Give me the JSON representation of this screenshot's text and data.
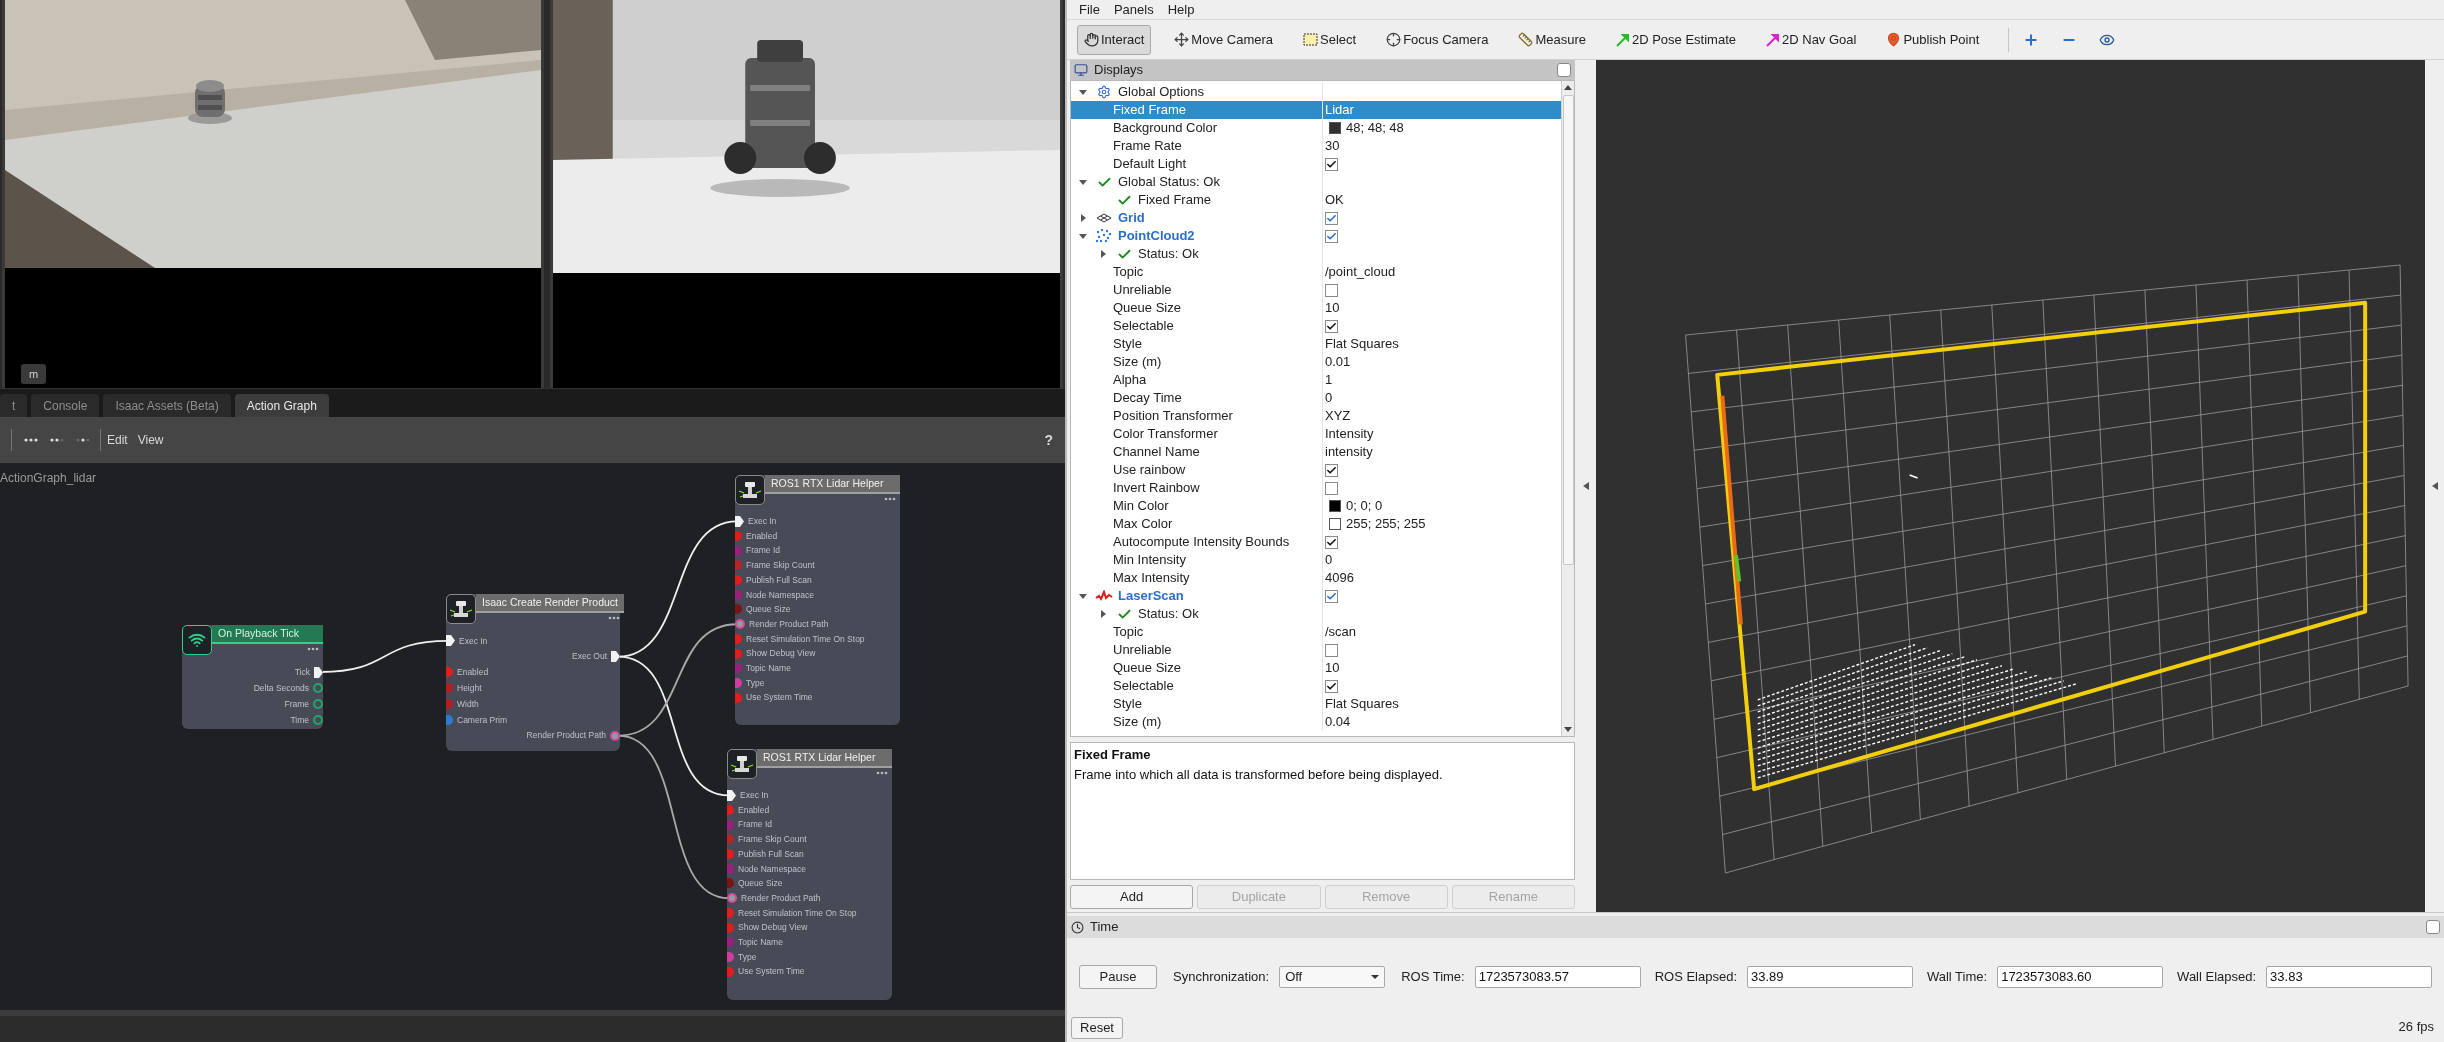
{
  "viewport": {
    "badge": "m"
  },
  "graph_editor": {
    "tabs": [
      {
        "label": "t",
        "selected": false
      },
      {
        "label": "Console",
        "selected": false
      },
      {
        "label": "Isaac Assets (Beta)",
        "selected": false
      },
      {
        "label": "Action Graph",
        "selected": true
      }
    ],
    "menu": [
      "Edit",
      "View"
    ],
    "help": "?",
    "graph_name": "ActionGraph_lidar",
    "nodes": [
      {
        "title": "On Playback Tick",
        "kind": "event",
        "ports": [
          {
            "label": "Tick",
            "kind": "exec_out"
          },
          {
            "label": "Delta Seconds",
            "kind": "ring_out",
            "color": "#1fa866"
          },
          {
            "label": "Frame",
            "kind": "ring_out",
            "color": "#1fa866"
          },
          {
            "label": "Time",
            "kind": "ring_out",
            "color": "#1fa866"
          }
        ]
      },
      {
        "title": "Isaac Create Render Product",
        "kind": "tool",
        "ports": [
          {
            "label": "Exec In",
            "kind": "exec_in"
          },
          {
            "label": "Exec Out",
            "kind": "exec_out"
          },
          {
            "label": "Enabled",
            "kind": "data_in",
            "color": "#e21d1d"
          },
          {
            "label": "Height",
            "kind": "data_in",
            "color": "#b01e22"
          },
          {
            "label": "Width",
            "kind": "data_in",
            "color": "#b01e22"
          },
          {
            "label": "Camera Prim",
            "kind": "data_in",
            "color": "#2e7bd6"
          },
          {
            "label": "Render Product Path",
            "kind": "dot_out",
            "color": "#d04aa0"
          }
        ]
      },
      {
        "title": "ROS1 RTX Lidar Helper",
        "kind": "tool",
        "ports": [
          {
            "label": "Exec In",
            "kind": "exec_in"
          },
          {
            "label": "Enabled",
            "kind": "data_in",
            "color": "#e21d1d"
          },
          {
            "label": "Frame Id",
            "kind": "data_in",
            "color": "#9b1f7c"
          },
          {
            "label": "Frame Skip Count",
            "kind": "data_in",
            "color": "#b0262a"
          },
          {
            "label": "Publish Full Scan",
            "kind": "data_in",
            "color": "#e21d1d"
          },
          {
            "label": "Node Namespace",
            "kind": "data_in",
            "color": "#9b1f7c"
          },
          {
            "label": "Queue Size",
            "kind": "data_in",
            "color": "#7a1515"
          },
          {
            "label": "Render Product Path",
            "kind": "dot_in",
            "color": "#d04aa0"
          },
          {
            "label": "Reset Simulation Time On Stop",
            "kind": "data_in",
            "color": "#e21d1d"
          },
          {
            "label": "Show Debug View",
            "kind": "data_in",
            "color": "#e21d1d"
          },
          {
            "label": "Topic Name",
            "kind": "data_in",
            "color": "#9b1f7c"
          },
          {
            "label": "Type",
            "kind": "data_in",
            "color": "#d23ca0"
          },
          {
            "label": "Use System Time",
            "kind": "data_in",
            "color": "#e21d1d"
          }
        ]
      },
      {
        "title": "ROS1 RTX Lidar Helper",
        "kind": "tool",
        "ports": [
          {
            "label": "Exec In",
            "kind": "exec_in"
          },
          {
            "label": "Enabled",
            "kind": "data_in",
            "color": "#e21d1d"
          },
          {
            "label": "Frame Id",
            "kind": "data_in",
            "color": "#9b1f7c"
          },
          {
            "label": "Frame Skip Count",
            "kind": "data_in",
            "color": "#b0262a"
          },
          {
            "label": "Publish Full Scan",
            "kind": "data_in",
            "color": "#e21d1d"
          },
          {
            "label": "Node Namespace",
            "kind": "data_in",
            "color": "#9b1f7c"
          },
          {
            "label": "Queue Size",
            "kind": "data_in",
            "color": "#7a1515"
          },
          {
            "label": "Render Product Path",
            "kind": "dot_in",
            "color": "#d04aa0"
          },
          {
            "label": "Reset Simulation Time On Stop",
            "kind": "data_in",
            "color": "#e21d1d"
          },
          {
            "label": "Show Debug View",
            "kind": "data_in",
            "color": "#e21d1d"
          },
          {
            "label": "Topic Name",
            "kind": "data_in",
            "color": "#9b1f7c"
          },
          {
            "label": "Type",
            "kind": "data_in",
            "color": "#d23ca0"
          },
          {
            "label": "Use System Time",
            "kind": "data_in",
            "color": "#e21d1d"
          }
        ]
      }
    ]
  },
  "rviz": {
    "menu": [
      "File",
      "Panels",
      "Help"
    ],
    "tools": [
      {
        "label": "Interact",
        "kind": "interact",
        "selected": true
      },
      {
        "label": "Move Camera",
        "kind": "move",
        "selected": false
      },
      {
        "label": "Select",
        "kind": "select",
        "selected": false
      },
      {
        "label": "Focus Camera",
        "kind": "focus",
        "selected": false
      },
      {
        "label": "Measure",
        "kind": "measure",
        "selected": false
      },
      {
        "label": "2D Pose Estimate",
        "kind": "pose",
        "selected": false
      },
      {
        "label": "2D Nav Goal",
        "kind": "goal",
        "selected": false
      },
      {
        "label": "Publish Point",
        "kind": "point",
        "selected": false
      }
    ],
    "displays": {
      "title": "Displays",
      "tree": [
        {
          "label": "Global Options",
          "kind": "options",
          "expanded": true,
          "selected": false,
          "children": [
            {
              "label": "Fixed Frame",
              "kind": "prop",
              "value": "Lidar",
              "selected": true
            },
            {
              "label": "Background Color",
              "kind": "prop",
              "color": "#303030",
              "value": "48; 48; 48",
              "selected": false
            },
            {
              "label": "Frame Rate",
              "kind": "prop",
              "value": "30",
              "selected": false
            },
            {
              "label": "Default Light",
              "kind": "prop",
              "checked": true,
              "selected": false
            }
          ]
        },
        {
          "label": "Global Status: Ok",
          "kind": "status",
          "expanded": true,
          "selected": false,
          "children": [
            {
              "label": "Fixed Frame",
              "kind": "status",
              "value": "OK",
              "selected": false
            }
          ]
        },
        {
          "label": "Grid",
          "kind": "grid",
          "expanded": false,
          "checked": true,
          "selected": false
        },
        {
          "label": "PointCloud2",
          "kind": "pointcloud",
          "expanded": true,
          "checked": true,
          "selected": false,
          "children": [
            {
              "label": "Status: Ok",
              "kind": "status",
              "expanded": false,
              "selected": false
            },
            {
              "label": "Topic",
              "kind": "prop",
              "value": "/point_cloud",
              "selected": false
            },
            {
              "label": "Unreliable",
              "kind": "prop",
              "checked": false,
              "selected": false
            },
            {
              "label": "Queue Size",
              "kind": "prop",
              "value": "10",
              "selected": false
            },
            {
              "label": "Selectable",
              "kind": "prop",
              "checked": true,
              "selected": false
            },
            {
              "label": "Style",
              "kind": "prop",
              "value": "Flat Squares",
              "selected": false
            },
            {
              "label": "Size (m)",
              "kind": "prop",
              "value": "0.01",
              "selected": false
            },
            {
              "label": "Alpha",
              "kind": "prop",
              "value": "1",
              "selected": false
            },
            {
              "label": "Decay Time",
              "kind": "prop",
              "value": "0",
              "selected": false
            },
            {
              "label": "Position Transformer",
              "kind": "prop",
              "value": "XYZ",
              "selected": false
            },
            {
              "label": "Color Transformer",
              "kind": "prop",
              "value": "Intensity",
              "selected": false
            },
            {
              "label": "Channel Name",
              "kind": "prop",
              "value": "intensity",
              "selected": false
            },
            {
              "label": "Use rainbow",
              "kind": "prop",
              "checked": true,
              "selected": false
            },
            {
              "label": "Invert Rainbow",
              "kind": "prop",
              "checked": false,
              "selected": false
            },
            {
              "label": "Min Color",
              "kind": "prop",
              "color": "#000000",
              "value": "0; 0; 0",
              "selected": false
            },
            {
              "label": "Max Color",
              "kind": "prop",
              "color": "#ffffff",
              "value": "255; 255; 255",
              "selected": false
            },
            {
              "label": "Autocompute Intensity Bounds",
              "kind": "prop",
              "checked": true,
              "selected": false
            },
            {
              "label": "Min Intensity",
              "kind": "prop",
              "value": "0",
              "selected": false
            },
            {
              "label": "Max Intensity",
              "kind": "prop",
              "value": "4096",
              "selected": false
            }
          ]
        },
        {
          "label": "LaserScan",
          "kind": "laserscan",
          "expanded": true,
          "checked": true,
          "selected": false,
          "children": [
            {
              "label": "Status: Ok",
              "kind": "status",
              "expanded": false,
              "selected": false
            },
            {
              "label": "Topic",
              "kind": "prop",
              "value": "/scan",
              "selected": false
            },
            {
              "label": "Unreliable",
              "kind": "prop",
              "checked": false,
              "selected": false
            },
            {
              "label": "Queue Size",
              "kind": "prop",
              "value": "10",
              "selected": false
            },
            {
              "label": "Selectable",
              "kind": "prop",
              "checked": true,
              "selected": false
            },
            {
              "label": "Style",
              "kind": "prop",
              "value": "Flat Squares",
              "selected": false
            },
            {
              "label": "Size (m)",
              "kind": "prop",
              "value": "0.04",
              "selected": false
            }
          ]
        }
      ],
      "description": {
        "title": "Fixed Frame",
        "text": "Frame into which all data is transformed before being displayed."
      },
      "buttons": [
        {
          "label": "Add",
          "disabled": false
        },
        {
          "label": "Duplicate",
          "disabled": true
        },
        {
          "label": "Remove",
          "disabled": true
        },
        {
          "label": "Rename",
          "disabled": true
        }
      ]
    },
    "time_panel": {
      "title": "Time",
      "pause": "Pause",
      "sync_label": "Synchronization:",
      "sync_value": "Off",
      "fields": [
        {
          "label": "ROS Time:",
          "value": "1723573083.57"
        },
        {
          "label": "ROS Elapsed:",
          "value": "33.89"
        },
        {
          "label": "Wall Time:",
          "value": "1723573083.60"
        },
        {
          "label": "Wall Elapsed:",
          "value": "33.83"
        }
      ],
      "reset": "Reset",
      "fps": "26 fps"
    }
  }
}
